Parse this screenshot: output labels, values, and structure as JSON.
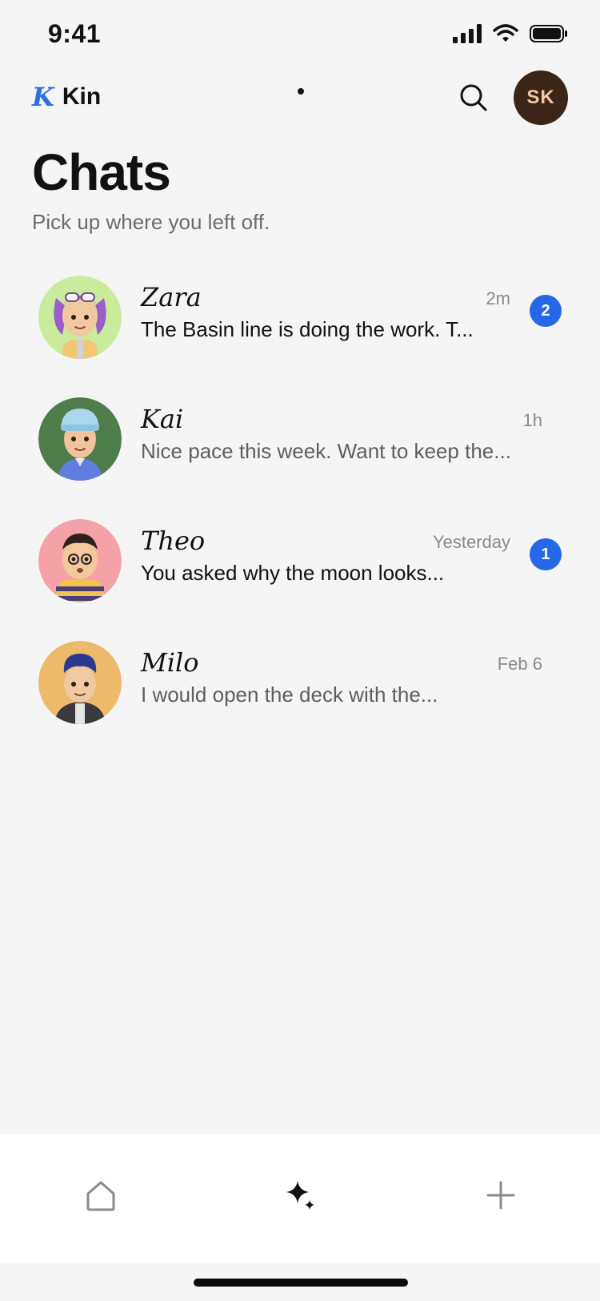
{
  "status_bar": {
    "time": "9:41"
  },
  "header": {
    "brand_mark": "K",
    "brand_name": "Kin",
    "profile_initials": "SK"
  },
  "page": {
    "title": "Chats",
    "subtitle": "Pick up where you left off."
  },
  "chats": [
    {
      "name": "Zara",
      "time": "2m",
      "preview": "The Basin line is doing the work. T...",
      "unread_count": "2",
      "unread": true,
      "avatar_color": "#c9ec9c",
      "avatar_icon": "avatar-zara"
    },
    {
      "name": "Kai",
      "time": "1h",
      "preview": "Nice pace this week. Want to keep the...",
      "unread_count": null,
      "unread": false,
      "avatar_color": "#4e7c4a",
      "avatar_icon": "avatar-kai"
    },
    {
      "name": "Theo",
      "time": "Yesterday",
      "preview": "You asked why the moon looks...",
      "unread_count": "1",
      "unread": true,
      "avatar_color": "#f4a2a8",
      "avatar_icon": "avatar-theo"
    },
    {
      "name": "Milo",
      "time": "Feb 6",
      "preview": "I would open the deck with the...",
      "unread_count": null,
      "unread": false,
      "avatar_color": "#edb96a",
      "avatar_icon": "avatar-milo"
    }
  ],
  "tab_bar": {
    "tabs": [
      {
        "icon": "home-icon",
        "active": false
      },
      {
        "icon": "sparkle-icon",
        "active": true
      },
      {
        "icon": "plus-icon",
        "active": false
      }
    ]
  },
  "colors": {
    "accent": "#2468e8",
    "brand": "#2f6fe4",
    "background": "#f5f5f5",
    "profile_avatar": "#3b2517"
  }
}
